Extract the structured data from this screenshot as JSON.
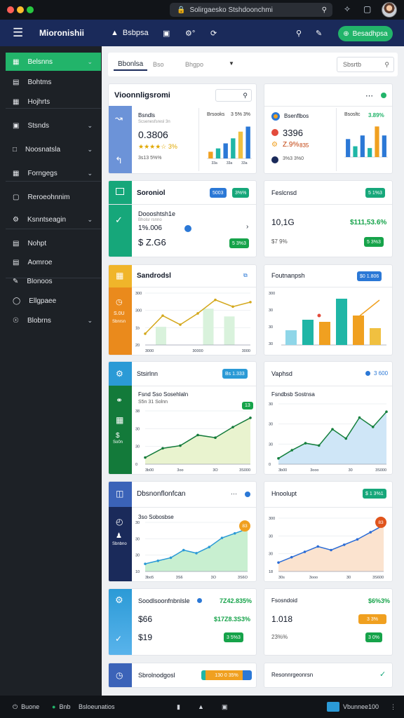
{
  "window": {
    "url": "Solirgaesko Stshdoonchmi"
  },
  "appbar": {
    "title": "Mioronishii",
    "nav1": "Bsbpsa",
    "cta": "Besadhpsa"
  },
  "sidebar": {
    "items": [
      {
        "label": "Belsnns",
        "chev": true
      },
      {
        "label": "Bohtms",
        "chev": false
      },
      {
        "label": "Hojhrts",
        "chev": false
      },
      {
        "label": "Stsnds",
        "chev": true
      },
      {
        "label": "Noosnatsla",
        "chev": true
      },
      {
        "label": "Forngegs",
        "chev": true
      },
      {
        "label": "Reroeohnnim",
        "chev": false
      },
      {
        "label": "Ksnntseagin",
        "chev": true
      },
      {
        "label": "Nohpt",
        "chev": false
      },
      {
        "label": "Aomroe",
        "chev": false
      },
      {
        "label": "Blonoos",
        "chev": false
      },
      {
        "label": "Ellgpaee",
        "chev": false
      },
      {
        "label": "Blobrns",
        "chev": true
      }
    ]
  },
  "topbar": {
    "tabs": [
      "Bbonlsa",
      "Bso",
      "Bhgpo"
    ],
    "search_placeholder": "Sbsrtb"
  },
  "cards": {
    "c1": {
      "title": "Vioonnligsromi",
      "sub": "Bsndls",
      "sub2": "Scsenesfsresl 3n",
      "big": "0.3806",
      "rating": "3%",
      "foot": "3s13 5%%",
      "stat_label": "Brsooks",
      "stat_val": "3 5% 3%",
      "ticks": [
        "33a",
        "33a",
        "33a"
      ]
    },
    "c2": {
      "heading": "Bsenflbos",
      "stat_label": "Bsosltc",
      "stat_val": "3.89%",
      "big": "3396",
      "mid": "Z.9%",
      "mid2": "835",
      "foot": "3%3 3%0"
    },
    "c3": {
      "title": "Soroniol",
      "b1": "5003",
      "b2": "3%%",
      "lbl": "Doooshtsh1e",
      "lbl2": "Bholsr rsnno",
      "val": "1%.006",
      "big": "$ Z.G6",
      "pill": "5 3%3"
    },
    "c4": {
      "title": "Feslcnsd",
      "pill": "5 1%3",
      "big": "10,1G",
      "val": "$111,53.6%",
      "foot": "$7 9%",
      "pill2": "5 3%3"
    },
    "c5": {
      "title": "Sandrodsl",
      "side1": "S.0U",
      "side2": "Sbnrsn",
      "y": [
        "300",
        "300",
        "1b",
        "20"
      ],
      "x": [
        "3000",
        "30000",
        "3000"
      ]
    },
    "c6": {
      "title": "Foutnanpsh",
      "pill": "$0 1.806",
      "y": [
        "300",
        "30",
        "30",
        "30"
      ]
    },
    "c7": {
      "title": "Stsirlnn",
      "pill": "Bs 1.333",
      "lbl": "Fsnd Sso Sosehlaln",
      "lbl2": "S5n 31 Solnn",
      "badge": "13",
      "y": [
        "38",
        "30",
        "30",
        "0"
      ],
      "x": [
        "3b00",
        "3oo",
        "3O",
        "3S000"
      ],
      "side": "So0n"
    },
    "c8": {
      "title": "Vaphsd",
      "val": "3 600",
      "lbl": "Fsndbsb Sostnsa",
      "y": [
        "30",
        "30",
        "30",
        "0"
      ],
      "x": [
        "3b00",
        "3ooo",
        "30",
        "3S000"
      ]
    },
    "c9": {
      "title": "Dbsnonflonfcan",
      "lbl": "3so Sobosbse",
      "y": [
        "30",
        "30",
        "30",
        "10"
      ],
      "x": [
        "3bo5",
        "3S6",
        "3O",
        "3S6O"
      ],
      "badge": "83",
      "side": "Sbnbno"
    },
    "c10": {
      "title": "Hnoolupt",
      "pill": "$ 1 3%1",
      "y": [
        "300",
        "30",
        "30",
        "18"
      ],
      "x": [
        "30s",
        "3ooo",
        "30",
        "3S600"
      ],
      "badge": "83"
    },
    "c11": {
      "title": "Soodlsoonfnbnlsle",
      "stat": "7Z42.835%",
      "val1": "$66",
      "val1b": "$17Z8.3S3%",
      "val2": "$19",
      "pill": "3 5%3"
    },
    "c12": {
      "title": "Fsosndoid",
      "stat": "$6%3%",
      "big": "1.018",
      "pill": "3 3%",
      "foot": "23%%",
      "pill2": "3 0%"
    },
    "c13": {
      "title": "Sbrolnodgosl",
      "pill": "130 0 35%"
    },
    "c14": {
      "title": "Resonnrgeonrsn"
    }
  },
  "bottom": {
    "a": "Buone",
    "b": "Bnb",
    "c": "Bsloeunatios",
    "right": "Vbunnee100"
  },
  "chart_data": [
    {
      "type": "bar",
      "categories": [
        "a",
        "b",
        "c",
        "d",
        "e",
        "f"
      ],
      "series": [
        {
          "values": [
            20,
            30,
            45,
            60,
            80,
            95
          ]
        }
      ]
    },
    {
      "type": "bar",
      "categories": [
        "a",
        "b",
        "c",
        "d",
        "e",
        "f"
      ],
      "series": [
        {
          "values": [
            50,
            30,
            60,
            25,
            85,
            60
          ]
        }
      ]
    },
    {
      "type": "line",
      "x": [
        "3000",
        "30000",
        "3000"
      ],
      "series": [
        {
          "values": [
            10,
            26,
            18,
            28,
            40,
            34,
            38
          ]
        }
      ]
    },
    {
      "type": "bar",
      "categories": [
        "a",
        "b",
        "c",
        "d",
        "e",
        "f"
      ],
      "series": [
        {
          "values": [
            35,
            60,
            55,
            110,
            70,
            40
          ]
        }
      ]
    },
    {
      "type": "area",
      "x": [
        "3b00",
        "3oo",
        "3O",
        "3S000"
      ],
      "series": [
        {
          "values": [
            5,
            12,
            14,
            22,
            20,
            28,
            35
          ]
        }
      ]
    },
    {
      "type": "area",
      "x": [
        "3b00",
        "3ooo",
        "30",
        "3S000"
      ],
      "series": [
        {
          "values": [
            5,
            12,
            18,
            16,
            30,
            22,
            40,
            32,
            45
          ]
        }
      ]
    },
    {
      "type": "area",
      "x": [
        "3bo5",
        "3S6",
        "3O",
        "3S6O"
      ],
      "series": [
        {
          "values": [
            10,
            14,
            18,
            28,
            24,
            32,
            44,
            50,
            56
          ]
        }
      ]
    },
    {
      "type": "area",
      "x": [
        "30s",
        "3ooo",
        "30",
        "3S600"
      ],
      "series": [
        {
          "values": [
            10,
            16,
            22,
            28,
            24,
            30,
            36,
            44,
            52
          ]
        }
      ]
    }
  ],
  "colors": {
    "navy": "#1a2a5a",
    "green": "#22b46a",
    "blue": "#2b78d6",
    "orange": "#f0a020",
    "teal": "#1fb6a6"
  }
}
